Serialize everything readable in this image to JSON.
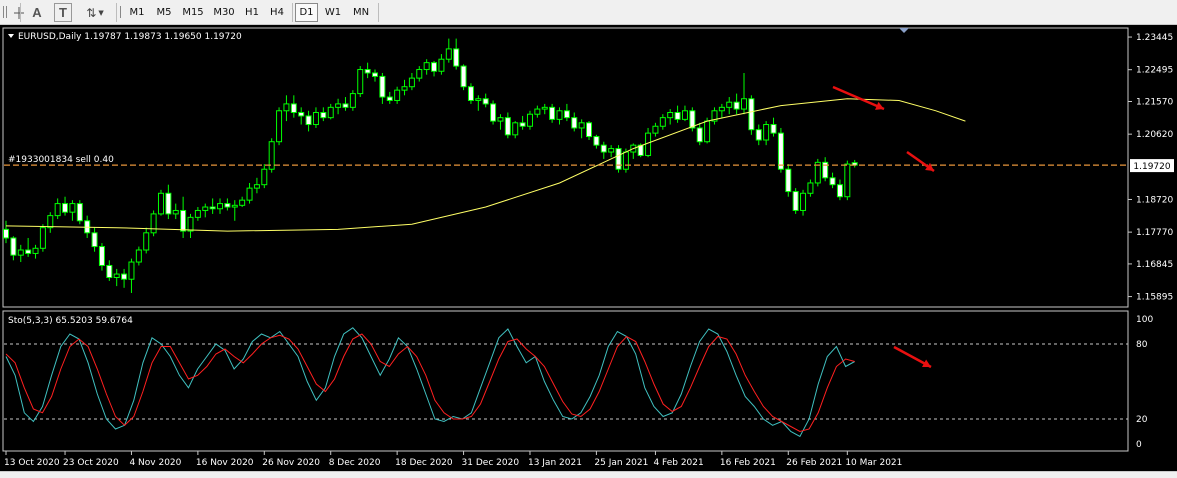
{
  "toolbar": {
    "tools": [
      {
        "name": "text-label-tool",
        "glyph": "A"
      },
      {
        "name": "text-box-tool",
        "glyph": "T"
      },
      {
        "name": "arrows-tool",
        "glyph": "⇅"
      }
    ],
    "timeframes": [
      "M1",
      "M5",
      "M15",
      "M30",
      "H1",
      "H4",
      "D1",
      "W1",
      "MN"
    ],
    "active_timeframe": "D1"
  },
  "chart": {
    "header": "EURUSD,Daily  1.19787 1.19873 1.19650 1.19720",
    "order_label": "#1933001834 sell 0.40",
    "current_price": "1.19720",
    "price_scale": [
      "1.23445",
      "1.22495",
      "1.21570",
      "1.20620",
      "1.18720",
      "1.17770",
      "1.16845",
      "1.15895"
    ],
    "time_scale": [
      "13 Oct 2020",
      "23 Oct 2020",
      "4 Nov 2020",
      "16 Nov 2020",
      "26 Nov 2020",
      "8 Dec 2020",
      "18 Dec 2020",
      "31 Dec 2020",
      "13 Jan 2021",
      "25 Jan 2021",
      "4 Feb 2021",
      "16 Feb 2021",
      "26 Feb 2021",
      "10 Mar 2021"
    ],
    "bull_color": "#00ff00",
    "bear_color": "#ffffff",
    "ma_color": "#ffff66",
    "order_line_color": "#e8963b",
    "arrow_color": "#e81010"
  },
  "indicator": {
    "header": "Sto(5,3,3) 65.5203 59.6764",
    "scale": [
      "100",
      "80",
      "20",
      "0"
    ],
    "main_color": "#40c0c0",
    "signal_color": "#ff2020"
  },
  "chart_data": {
    "type": "candlestick",
    "symbol": "EURUSD",
    "timeframe": "Daily",
    "ylim": [
      1.1565,
      1.2365
    ],
    "candles": [
      [
        1.1785,
        1.181,
        1.1745,
        1.176
      ],
      [
        1.176,
        1.1765,
        1.1695,
        1.171
      ],
      [
        1.171,
        1.174,
        1.169,
        1.1725
      ],
      [
        1.1725,
        1.176,
        1.1705,
        1.1715
      ],
      [
        1.1715,
        1.174,
        1.17,
        1.173
      ],
      [
        1.173,
        1.18,
        1.172,
        1.179
      ],
      [
        1.179,
        1.1835,
        1.1775,
        1.1825
      ],
      [
        1.1825,
        1.1875,
        1.1815,
        1.186
      ],
      [
        1.186,
        1.188,
        1.1825,
        1.1835
      ],
      [
        1.1835,
        1.187,
        1.181,
        1.186
      ],
      [
        1.186,
        1.187,
        1.18,
        1.181
      ],
      [
        1.181,
        1.1825,
        1.176,
        1.1775
      ],
      [
        1.1775,
        1.179,
        1.172,
        1.1735
      ],
      [
        1.1735,
        1.1745,
        1.1665,
        1.168
      ],
      [
        1.168,
        1.1695,
        1.1635,
        1.1645
      ],
      [
        1.1645,
        1.167,
        1.162,
        1.1655
      ],
      [
        1.1655,
        1.167,
        1.1615,
        1.164
      ],
      [
        1.164,
        1.17,
        1.16,
        1.169
      ],
      [
        1.169,
        1.1735,
        1.168,
        1.1725
      ],
      [
        1.1725,
        1.179,
        1.1715,
        1.1775
      ],
      [
        1.1775,
        1.184,
        1.1765,
        1.183
      ],
      [
        1.183,
        1.19,
        1.1825,
        1.189
      ],
      [
        1.189,
        1.1915,
        1.1815,
        1.183
      ],
      [
        1.183,
        1.186,
        1.1815,
        1.184
      ],
      [
        1.184,
        1.188,
        1.176,
        1.178
      ],
      [
        1.178,
        1.183,
        1.176,
        1.182
      ],
      [
        1.182,
        1.185,
        1.181,
        1.184
      ],
      [
        1.184,
        1.186,
        1.182,
        1.185
      ],
      [
        1.185,
        1.1875,
        1.183,
        1.1845
      ],
      [
        1.1845,
        1.1875,
        1.183,
        1.186
      ],
      [
        1.186,
        1.1875,
        1.184,
        1.185
      ],
      [
        1.185,
        1.187,
        1.181,
        1.1855
      ],
      [
        1.1855,
        1.188,
        1.185,
        1.187
      ],
      [
        1.187,
        1.192,
        1.186,
        1.1905
      ],
      [
        1.1905,
        1.1935,
        1.189,
        1.1915
      ],
      [
        1.1915,
        1.1975,
        1.1905,
        1.196
      ],
      [
        1.196,
        1.205,
        1.195,
        1.204
      ],
      [
        1.204,
        1.214,
        1.203,
        1.213
      ],
      [
        1.213,
        1.2175,
        1.21,
        1.215
      ],
      [
        1.215,
        1.2175,
        1.211,
        1.2125
      ],
      [
        1.2125,
        1.214,
        1.209,
        1.2115
      ],
      [
        1.2115,
        1.213,
        1.207,
        1.209
      ],
      [
        1.209,
        1.214,
        1.208,
        1.2125
      ],
      [
        1.2125,
        1.214,
        1.21,
        1.211
      ],
      [
        1.211,
        1.215,
        1.2105,
        1.214
      ],
      [
        1.214,
        1.2165,
        1.212,
        1.215
      ],
      [
        1.215,
        1.217,
        1.213,
        1.214
      ],
      [
        1.214,
        1.219,
        1.213,
        1.218
      ],
      [
        1.218,
        1.226,
        1.217,
        1.225
      ],
      [
        1.225,
        1.227,
        1.2225,
        1.224
      ],
      [
        1.224,
        1.225,
        1.2215,
        1.223
      ],
      [
        1.223,
        1.224,
        1.215,
        1.217
      ],
      [
        1.217,
        1.2185,
        1.215,
        1.216
      ],
      [
        1.216,
        1.22,
        1.215,
        1.219
      ],
      [
        1.219,
        1.222,
        1.2175,
        1.22
      ],
      [
        1.22,
        1.224,
        1.219,
        1.2225
      ],
      [
        1.2225,
        1.226,
        1.2215,
        1.225
      ],
      [
        1.225,
        1.228,
        1.2235,
        1.227
      ],
      [
        1.227,
        1.2275,
        1.223,
        1.2245
      ],
      [
        1.2245,
        1.2295,
        1.2235,
        1.228
      ],
      [
        1.228,
        1.234,
        1.227,
        1.231
      ],
      [
        1.231,
        1.234,
        1.225,
        1.226
      ],
      [
        1.226,
        1.2265,
        1.219,
        1.22
      ],
      [
        1.22,
        1.221,
        1.215,
        1.216
      ],
      [
        1.216,
        1.2175,
        1.213,
        1.2165
      ],
      [
        1.2165,
        1.218,
        1.214,
        1.215
      ],
      [
        1.215,
        1.216,
        1.209,
        1.21
      ],
      [
        1.21,
        1.212,
        1.2075,
        1.211
      ],
      [
        1.211,
        1.2125,
        1.205,
        1.206
      ],
      [
        1.206,
        1.21,
        1.205,
        1.2095
      ],
      [
        1.2095,
        1.2115,
        1.2075,
        1.2085
      ],
      [
        1.2085,
        1.213,
        1.2075,
        1.212
      ],
      [
        1.212,
        1.2145,
        1.211,
        1.2135
      ],
      [
        1.2135,
        1.215,
        1.212,
        1.214
      ],
      [
        1.214,
        1.215,
        1.2095,
        1.2105
      ],
      [
        1.2105,
        1.214,
        1.209,
        1.213
      ],
      [
        1.213,
        1.215,
        1.21,
        1.211
      ],
      [
        1.211,
        1.2125,
        1.207,
        1.208
      ],
      [
        1.208,
        1.2105,
        1.205,
        1.2095
      ],
      [
        1.2095,
        1.21,
        1.2045,
        1.2055
      ],
      [
        1.2055,
        1.206,
        1.202,
        1.203
      ],
      [
        1.203,
        1.204,
        1.199,
        1.201
      ],
      [
        1.201,
        1.203,
        1.1995,
        1.202
      ],
      [
        1.202,
        1.203,
        1.195,
        1.196
      ],
      [
        1.196,
        1.202,
        1.195,
        1.201
      ],
      [
        1.201,
        1.2035,
        1.199,
        1.203
      ],
      [
        1.203,
        1.2035,
        1.1995,
        1.2
      ],
      [
        1.2,
        1.208,
        1.1995,
        1.2065
      ],
      [
        1.2065,
        1.2095,
        1.2055,
        1.2085
      ],
      [
        1.2085,
        1.212,
        1.2075,
        1.211
      ],
      [
        1.211,
        1.2135,
        1.209,
        1.2125
      ],
      [
        1.2125,
        1.2145,
        1.2095,
        1.2105
      ],
      [
        1.2105,
        1.2145,
        1.21,
        1.213
      ],
      [
        1.213,
        1.214,
        1.207,
        1.208
      ],
      [
        1.208,
        1.2095,
        1.203,
        1.204
      ],
      [
        1.204,
        1.211,
        1.2035,
        1.21
      ],
      [
        1.21,
        1.214,
        1.209,
        1.213
      ],
      [
        1.213,
        1.215,
        1.211,
        1.214
      ],
      [
        1.214,
        1.217,
        1.212,
        1.2155
      ],
      [
        1.2155,
        1.218,
        1.212,
        1.2135
      ],
      [
        1.2135,
        1.224,
        1.212,
        1.2165
      ],
      [
        1.2165,
        1.2175,
        1.206,
        1.2075
      ],
      [
        1.2075,
        1.209,
        1.203,
        1.2045
      ],
      [
        1.2045,
        1.21,
        1.203,
        1.209
      ],
      [
        1.209,
        1.211,
        1.2055,
        1.2065
      ],
      [
        1.2065,
        1.208,
        1.195,
        1.196
      ],
      [
        1.196,
        1.1975,
        1.188,
        1.1895
      ],
      [
        1.1895,
        1.1905,
        1.183,
        1.184
      ],
      [
        1.184,
        1.19,
        1.1825,
        1.189
      ],
      [
        1.189,
        1.193,
        1.188,
        1.192
      ],
      [
        1.192,
        1.199,
        1.191,
        1.198
      ],
      [
        1.198,
        1.1995,
        1.1925,
        1.1935
      ],
      [
        1.1935,
        1.195,
        1.1905,
        1.1915
      ],
      [
        1.1915,
        1.193,
        1.187,
        1.188
      ],
      [
        1.188,
        1.1985,
        1.187,
        1.1975
      ],
      [
        1.1979,
        1.1987,
        1.1965,
        1.1972
      ]
    ],
    "moving_average": [
      [
        0,
        1.1795
      ],
      [
        15,
        1.179
      ],
      [
        30,
        1.178
      ],
      [
        45,
        1.1785
      ],
      [
        55,
        1.18
      ],
      [
        65,
        1.185
      ],
      [
        75,
        1.192
      ],
      [
        85,
        1.202
      ],
      [
        95,
        1.21
      ],
      [
        105,
        1.2145
      ],
      [
        114,
        1.2165
      ],
      [
        121,
        1.216
      ],
      [
        126,
        1.213
      ],
      [
        130,
        1.21
      ]
    ],
    "order_price": 1.1972,
    "stochastic": {
      "ylim": [
        0,
        100
      ],
      "levels": [
        80,
        20
      ],
      "main": [
        70,
        55,
        25,
        18,
        30,
        55,
        78,
        88,
        84,
        65,
        40,
        20,
        12,
        15,
        35,
        65,
        85,
        80,
        70,
        55,
        45,
        60,
        70,
        80,
        75,
        60,
        68,
        82,
        88,
        85,
        90,
        80,
        70,
        50,
        35,
        45,
        70,
        88,
        93,
        85,
        70,
        55,
        68,
        85,
        78,
        60,
        40,
        20,
        18,
        22,
        20,
        25,
        45,
        65,
        85,
        92,
        78,
        65,
        70,
        50,
        35,
        22,
        20,
        25,
        38,
        55,
        78,
        90,
        86,
        72,
        45,
        30,
        22,
        25,
        40,
        62,
        82,
        92,
        88,
        74,
        55,
        38,
        30,
        20,
        15,
        18,
        10,
        6,
        20,
        48,
        70,
        78,
        62,
        66
      ],
      "signal": [
        72,
        65,
        45,
        28,
        25,
        38,
        60,
        78,
        84,
        78,
        60,
        40,
        22,
        15,
        22,
        42,
        65,
        78,
        78,
        65,
        52,
        55,
        62,
        72,
        76,
        70,
        65,
        72,
        80,
        85,
        87,
        84,
        76,
        62,
        48,
        42,
        52,
        70,
        84,
        88,
        80,
        66,
        62,
        72,
        78,
        70,
        55,
        35,
        25,
        20,
        20,
        22,
        32,
        50,
        68,
        82,
        84,
        76,
        70,
        62,
        48,
        34,
        24,
        22,
        28,
        42,
        60,
        78,
        86,
        82,
        66,
        48,
        32,
        26,
        30,
        45,
        62,
        78,
        86,
        84,
        72,
        55,
        42,
        30,
        22,
        18,
        14,
        10,
        12,
        25,
        45,
        62,
        68,
        66
      ]
    }
  }
}
